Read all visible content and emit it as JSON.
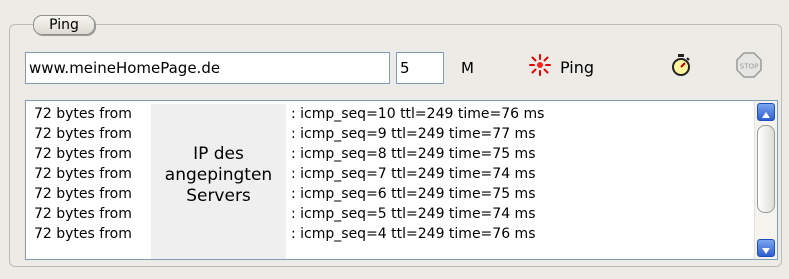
{
  "group": {
    "title": "Ping"
  },
  "controls": {
    "url": "www.meineHomePage.de",
    "count": "5",
    "count_unit": "M",
    "ping_label": "Ping"
  },
  "icons": {
    "ping": "sun-burst-icon",
    "timer": "stopwatch-icon",
    "stop": "stop-sign-icon"
  },
  "colors": {
    "ping_icon": "#e00000",
    "scroll_accent": "#2f5fd0"
  },
  "overlay": {
    "text": "IP des\nangepingten\nServers"
  },
  "log": [
    {
      "prefix": "72 bytes from",
      "detail": ": icmp_seq=10 ttl=249 time=76 ms"
    },
    {
      "prefix": "72 bytes from",
      "detail": ": icmp_seq=9 ttl=249 time=77 ms"
    },
    {
      "prefix": "72 bytes from",
      "detail": ": icmp_seq=8 ttl=249 time=75 ms"
    },
    {
      "prefix": "72 bytes from",
      "detail": ": icmp_seq=7 ttl=249 time=74 ms"
    },
    {
      "prefix": "72 bytes from",
      "detail": ": icmp_seq=6 ttl=249 time=75 ms"
    },
    {
      "prefix": "72 bytes from",
      "detail": ": icmp_seq=5 ttl=249 time=74 ms"
    },
    {
      "prefix": "72 bytes from",
      "detail": ": icmp_seq=4 ttl=249 time=76 ms"
    }
  ]
}
